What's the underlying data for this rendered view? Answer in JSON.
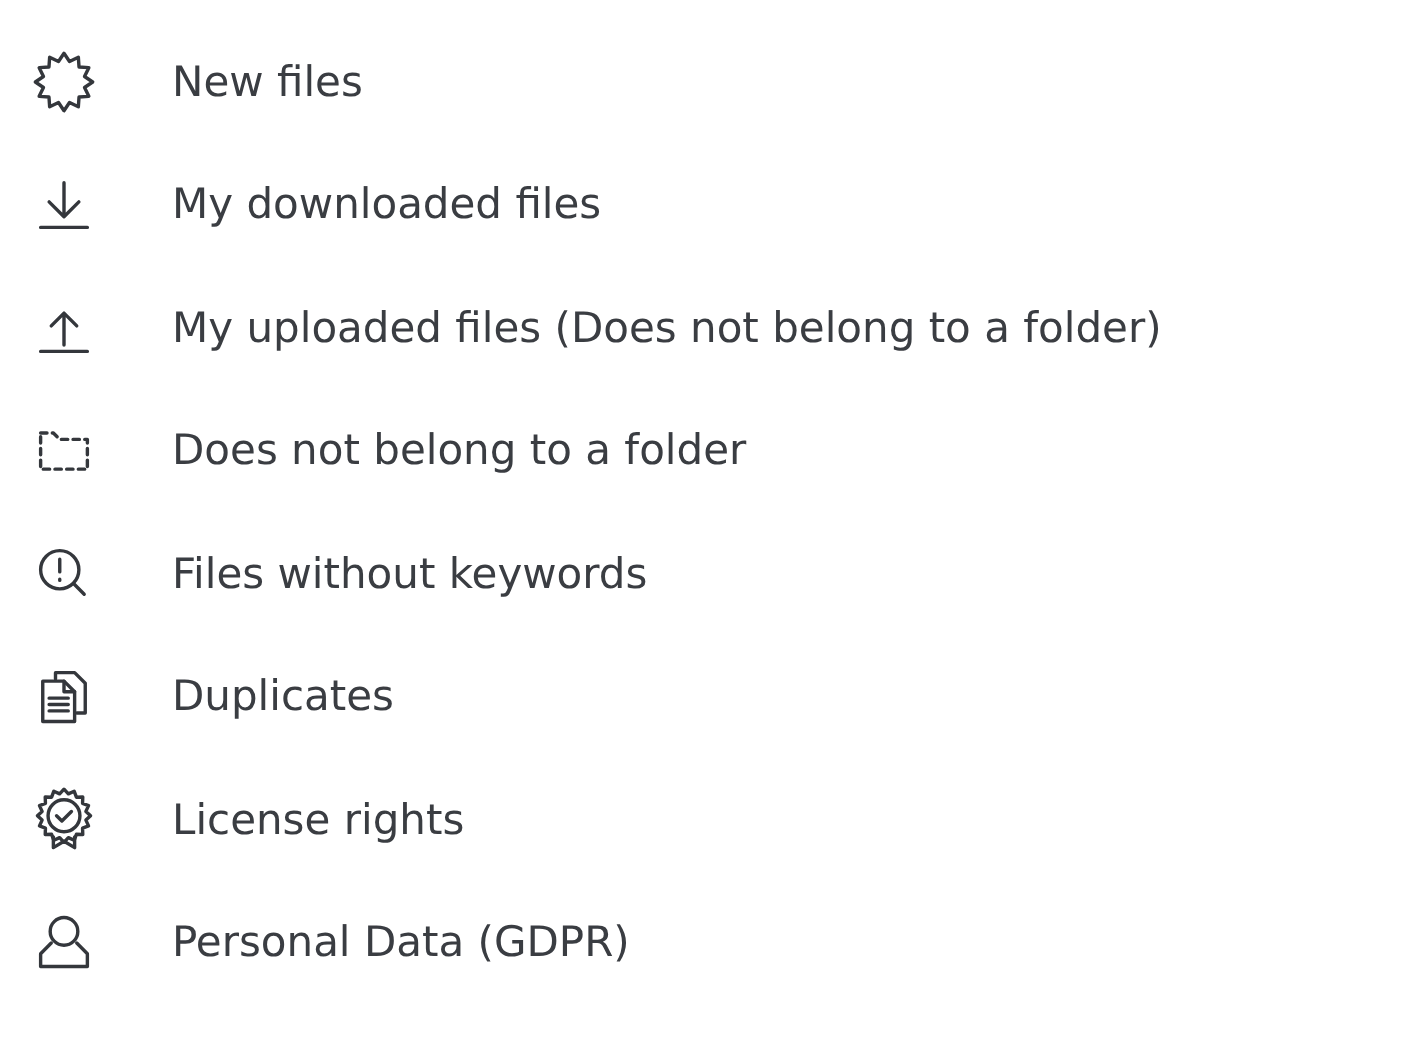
{
  "items": [
    {
      "kind": "new",
      "label": "New files"
    },
    {
      "kind": "downloaded",
      "label": "My downloaded files"
    },
    {
      "kind": "uploaded",
      "label": "My uploaded files (Does not belong to a folder)"
    },
    {
      "kind": "unfiled",
      "label": "Does not belong to a folder"
    },
    {
      "kind": "nokeywords",
      "label": "Files without keywords"
    },
    {
      "kind": "duplicates",
      "label": "Duplicates"
    },
    {
      "kind": "license",
      "label": "License rights"
    },
    {
      "kind": "personal",
      "label": "Personal Data (GDPR)"
    }
  ]
}
